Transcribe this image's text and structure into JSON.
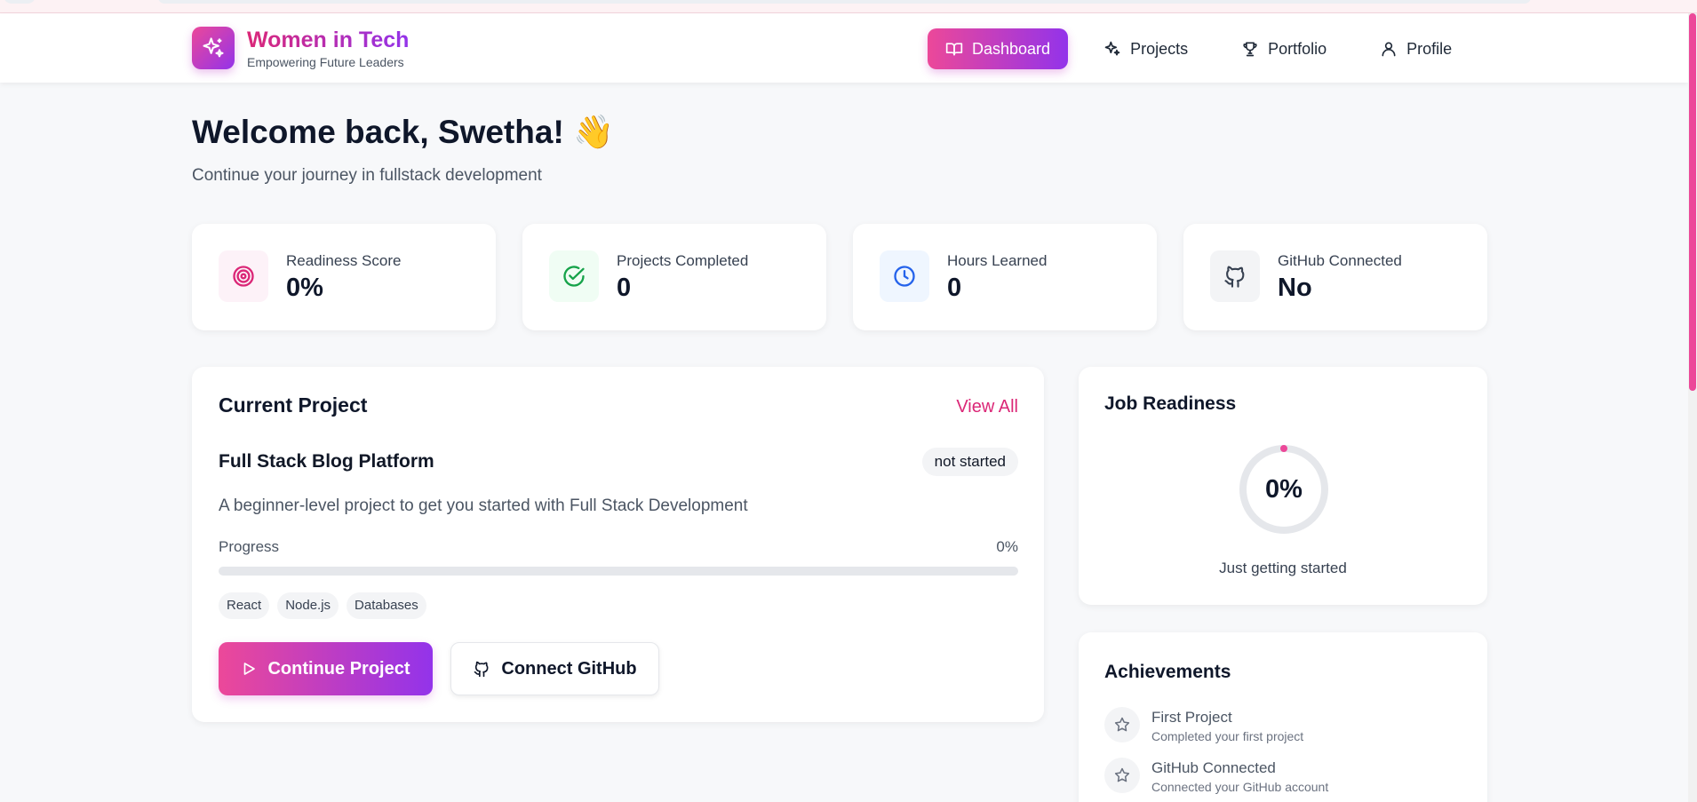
{
  "header": {
    "brand_title": "Women in Tech",
    "brand_subtitle": "Empowering Future Leaders",
    "nav": [
      {
        "label": "Dashboard",
        "icon": "book-open-icon",
        "active": true
      },
      {
        "label": "Projects",
        "icon": "sparkles-icon",
        "active": false
      },
      {
        "label": "Portfolio",
        "icon": "trophy-icon",
        "active": false
      },
      {
        "label": "Profile",
        "icon": "user-icon",
        "active": false
      }
    ]
  },
  "welcome": {
    "title": "Welcome back, Swetha! 👋",
    "subtitle": "Continue your journey in fullstack development"
  },
  "stats": [
    {
      "label": "Readiness Score",
      "value": "0%",
      "icon": "target-icon",
      "color": "#db2777"
    },
    {
      "label": "Projects Completed",
      "value": "0",
      "icon": "check-circle-icon",
      "color": "#16a34a"
    },
    {
      "label": "Hours Learned",
      "value": "0",
      "icon": "clock-icon",
      "color": "#2563eb"
    },
    {
      "label": "GitHub Connected",
      "value": "No",
      "icon": "github-icon",
      "color": "#374151"
    }
  ],
  "current_project": {
    "section_title": "Current Project",
    "view_all": "View All",
    "name": "Full Stack Blog Platform",
    "status": "not started",
    "description": "A beginner-level project to get you started with Full Stack Development",
    "progress_label": "Progress",
    "progress_text": "0%",
    "progress_percent": 0,
    "tags": [
      "React",
      "Node.js",
      "Databases"
    ],
    "continue_label": "Continue Project",
    "github_label": "Connect GitHub"
  },
  "job_readiness": {
    "title": "Job Readiness",
    "value_text": "0%",
    "value_percent": 0,
    "status": "Just getting started"
  },
  "achievements": {
    "title": "Achievements",
    "items": [
      {
        "title": "First Project",
        "description": "Completed your first project",
        "icon": "star-icon"
      },
      {
        "title": "GitHub Connected",
        "description": "Connected your GitHub account",
        "icon": "star-icon"
      }
    ]
  },
  "colors": {
    "accent_pink": "#ec4899",
    "accent_purple": "#9333ea",
    "link_pink": "#db2777"
  }
}
